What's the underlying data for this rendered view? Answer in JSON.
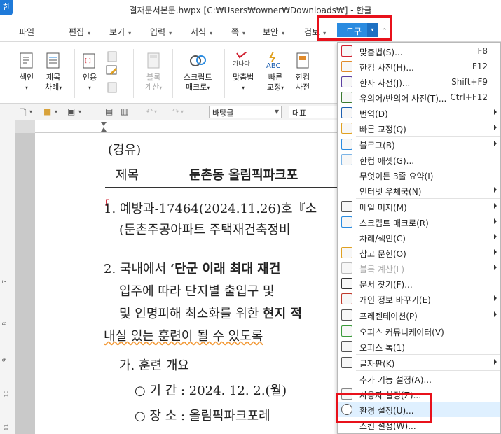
{
  "window": {
    "title": "결재문서본문.hwpx [C:₩Users₩owner₩Downloads₩] - 한글",
    "app_icon": "한"
  },
  "menubar": {
    "items": [
      "파일",
      "편집",
      "보기",
      "입력",
      "서식",
      "쪽",
      "보안",
      "검토"
    ],
    "active_tab": "도구"
  },
  "ribbon": {
    "buttons": [
      {
        "line1": "색인",
        "line2": ""
      },
      {
        "line1": "제목",
        "line2": "차례"
      },
      {
        "line1": "인용",
        "line2": ""
      },
      {
        "line1": "블록",
        "line2": "계산"
      },
      {
        "line1": "스크립트",
        "line2": "매크로"
      },
      {
        "line1": "맞춤법",
        "line2": ""
      },
      {
        "line1": "빠른",
        "line2": "교정"
      },
      {
        "line1": "한컴",
        "line2": "사전"
      }
    ],
    "spell_icon_text": "가나다",
    "abc_icon_text": "ABC"
  },
  "toolbar": {
    "style_combo": "바탕글",
    "para_combo": "대표"
  },
  "document": {
    "line_keyu": "(경유)",
    "title_label": "제목",
    "title_text": "둔촌동 올림픽파크포",
    "p1_mark": "「",
    "p1_line1": "1. 예방과-17464(2024.11.26)호『소",
    "p1_line2": "(둔촌주공아파트 주택재건축정비",
    "p2_line1_a": "2. 국내에서 ",
    "p2_line1_b": "‘단군 이래 최대 재건",
    "p2_line2": "입주에 따라 단지별 출입구 및",
    "p2_line3_a": "및 인명피해 최소화를 위한 ",
    "p2_line3_b": "현지 적",
    "p2_line4": "내실 있는 훈련이 될 수 있도록",
    "p3_head": "가. 훈련 개요",
    "p3_item1": "○ 기  간 : 2024. 12. 2.(월)",
    "p3_item2": "○ 장  소 : 올림픽파크포레"
  },
  "tools_menu": {
    "items": [
      {
        "icon": "spellcheck-icon",
        "label": "맞춤법(S)...",
        "shortcut": "F8"
      },
      {
        "icon": "dictionary-icon",
        "label": "한컴 사전(H)...",
        "shortcut": "F12"
      },
      {
        "icon": "hanja-dictionary-icon",
        "label": "한자 사전(J)...",
        "shortcut": "Shift+F9"
      },
      {
        "icon": "synonym-dictionary-icon",
        "label": "유의어/반의어 사전(T)...",
        "shortcut": "Ctrl+F12"
      },
      {
        "icon": "translate-icon",
        "label": "번역(D)",
        "submenu": true
      },
      {
        "icon": "quick-correct-icon",
        "label": "빠른 교정(Q)",
        "submenu": true
      },
      {
        "sep": true
      },
      {
        "icon": "blog-icon",
        "label": "블로그(B)",
        "submenu": true
      },
      {
        "icon": "hancom-asset-icon",
        "label": "한컴 애셋(G)..."
      },
      {
        "icon": "",
        "label": "무엇이든 3줄 요약(I)"
      },
      {
        "icon": "",
        "label": "인터넷 우체국(N)",
        "submenu": true
      },
      {
        "sep": true
      },
      {
        "icon": "mail-merge-icon",
        "label": "메일 머지(M)",
        "submenu": true
      },
      {
        "icon": "script-macro-icon",
        "label": "스크립트 매크로(R)",
        "submenu": true
      },
      {
        "icon": "",
        "label": "차례/색인(C)",
        "submenu": true
      },
      {
        "icon": "references-icon",
        "label": "참고 문헌(O)",
        "submenu": true
      },
      {
        "icon": "block-calc-icon",
        "label": "블록 계산(L)",
        "submenu": true,
        "disabled": true
      },
      {
        "icon": "binoculars-icon",
        "label": "문서 찾기(F)..."
      },
      {
        "icon": "privacy-icon",
        "label": "개인 정보 바꾸기(E)",
        "submenu": true
      },
      {
        "sep": true
      },
      {
        "icon": "presentation-icon",
        "label": "프레젠테이션(P)",
        "submenu": true
      },
      {
        "sep": true
      },
      {
        "icon": "office-communicator-icon",
        "label": "오피스 커뮤니케이터(V)"
      },
      {
        "icon": "office-talk-icon",
        "label": "오피스 톡(1)"
      },
      {
        "sep": true
      },
      {
        "icon": "keyboard-icon",
        "label": "글자판(K)",
        "submenu": true
      },
      {
        "sep": true
      },
      {
        "icon": "",
        "label": "추가 기능 설정(A)..."
      },
      {
        "icon": "user-settings-icon",
        "label": "사용자 설정(Z)..."
      },
      {
        "icon": "gear-icon",
        "label": "환경 설정(U)...",
        "highlight": true
      },
      {
        "icon": "",
        "label": "스킨 설정(W)..."
      }
    ]
  },
  "colors": {
    "accent": "#2a8be0",
    "highlight_box": "#e8111b",
    "menu_hover": "#dff0ff"
  }
}
